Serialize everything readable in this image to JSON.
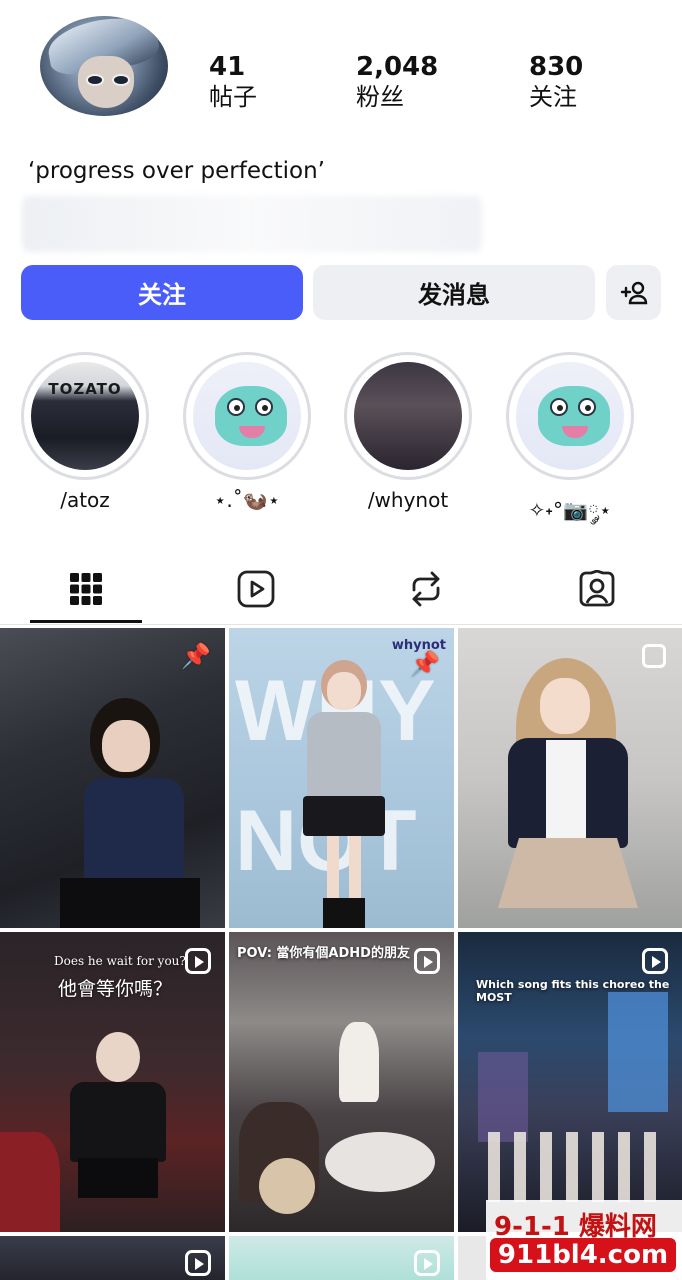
{
  "profile": {
    "stats": [
      {
        "value": "41",
        "label": "帖子"
      },
      {
        "value": "2,048",
        "label": "粉丝"
      },
      {
        "value": "830",
        "label": "关注"
      }
    ],
    "bio": "‘progress over perfection’"
  },
  "actions": {
    "follow_label": "关注",
    "message_label": "发消息",
    "add_icon": "add-person-icon"
  },
  "highlights": [
    {
      "caption": "/atoz",
      "cover_text": "TOZATO"
    },
    {
      "caption": "⋆.˚🦦⋆"
    },
    {
      "caption": "/whynot"
    },
    {
      "caption": "✧˖°📷༘⋆"
    }
  ],
  "tabs": [
    {
      "name": "grid",
      "icon": "grid-icon",
      "active": true
    },
    {
      "name": "reels",
      "icon": "reels-icon",
      "active": false
    },
    {
      "name": "reposts",
      "icon": "repost-icon",
      "active": false
    },
    {
      "name": "tagged",
      "icon": "tagged-icon",
      "active": false
    }
  ],
  "posts": [
    {
      "type": "pinned",
      "overlay": ""
    },
    {
      "type": "pinned",
      "overlay": "whynot"
    },
    {
      "type": "photo",
      "overlay": ""
    },
    {
      "type": "reel",
      "overlay_line1": "Does he wait for you?",
      "overlay_line2": "他會等你嗎？"
    },
    {
      "type": "reel",
      "overlay_line1": "POV: 當你有個ADHD的朋友"
    },
    {
      "type": "reel",
      "overlay_line1": "Which song fits this choreo the MOST"
    }
  ],
  "watermark": {
    "top": "9-1-1 爆料网",
    "bottom": "911bl4.com"
  },
  "colors": {
    "accent": "#4a5df9",
    "button_secondary": "#eeeff3"
  }
}
